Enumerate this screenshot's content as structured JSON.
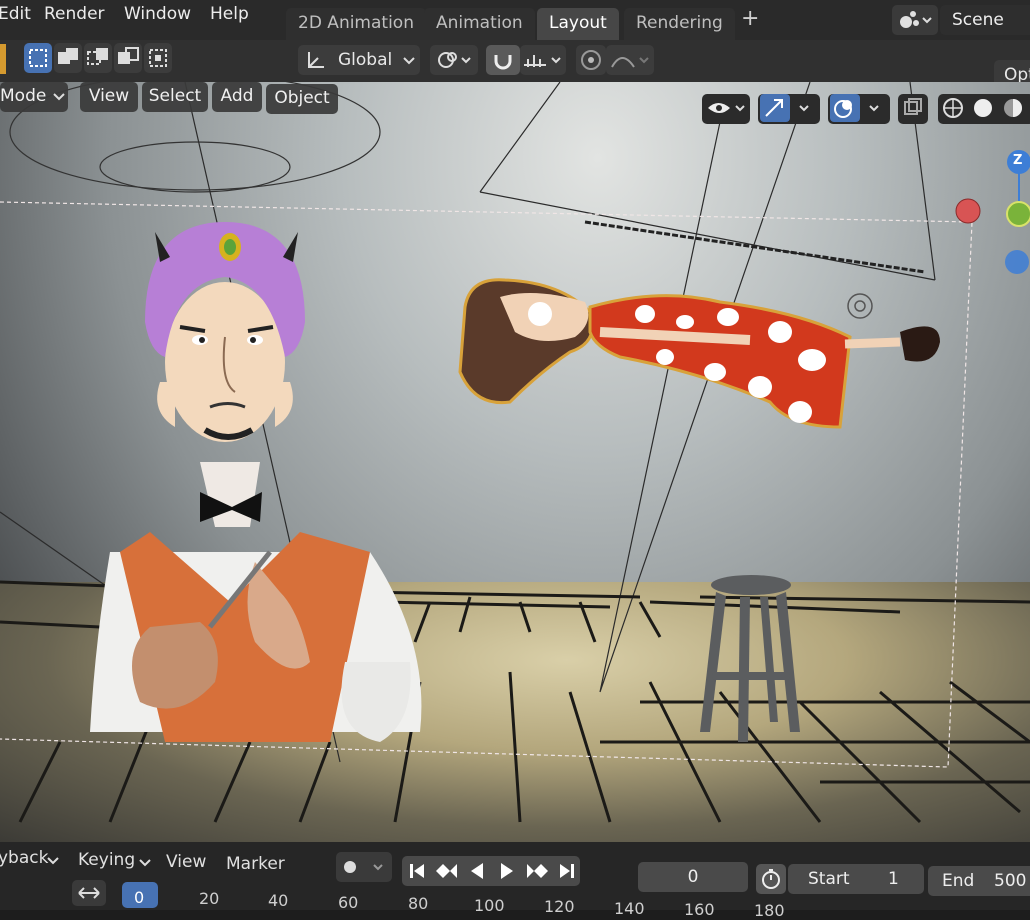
{
  "menubar": {
    "menus": [
      "Edit",
      "Render",
      "Window",
      "Help"
    ],
    "workspace_tabs": [
      "2D Animation",
      "Animation",
      "Layout",
      "Rendering"
    ],
    "active_tab": "Layout",
    "add_tab": "+",
    "scene_label": "Scene"
  },
  "header_tools": {
    "transform_orientation": "Global",
    "options_label": "Opt"
  },
  "viewport_header": {
    "mode": "Mode",
    "menus": [
      "View",
      "Select",
      "Add",
      "Object"
    ]
  },
  "gizmo": {
    "z_label": "Z"
  },
  "timeline": {
    "playback_label": "yback",
    "keying_label": "Keying",
    "view_label": "View",
    "marker_label": "Marker",
    "current_frame": "0",
    "start_label": "Start",
    "start_value": "1",
    "end_label": "End",
    "end_value": "500",
    "ruler_ticks": [
      "0",
      "20",
      "40",
      "60",
      "80",
      "100",
      "120",
      "140",
      "160",
      "180"
    ]
  },
  "colors": {
    "accent": "#4772b3",
    "turban": "#b77fd6",
    "vest": "#d7703a",
    "dress": "#d2391d",
    "gizmo_red": "#d04848",
    "gizmo_green": "#7ab33a",
    "gizmo_blue": "#3d7ed6"
  }
}
